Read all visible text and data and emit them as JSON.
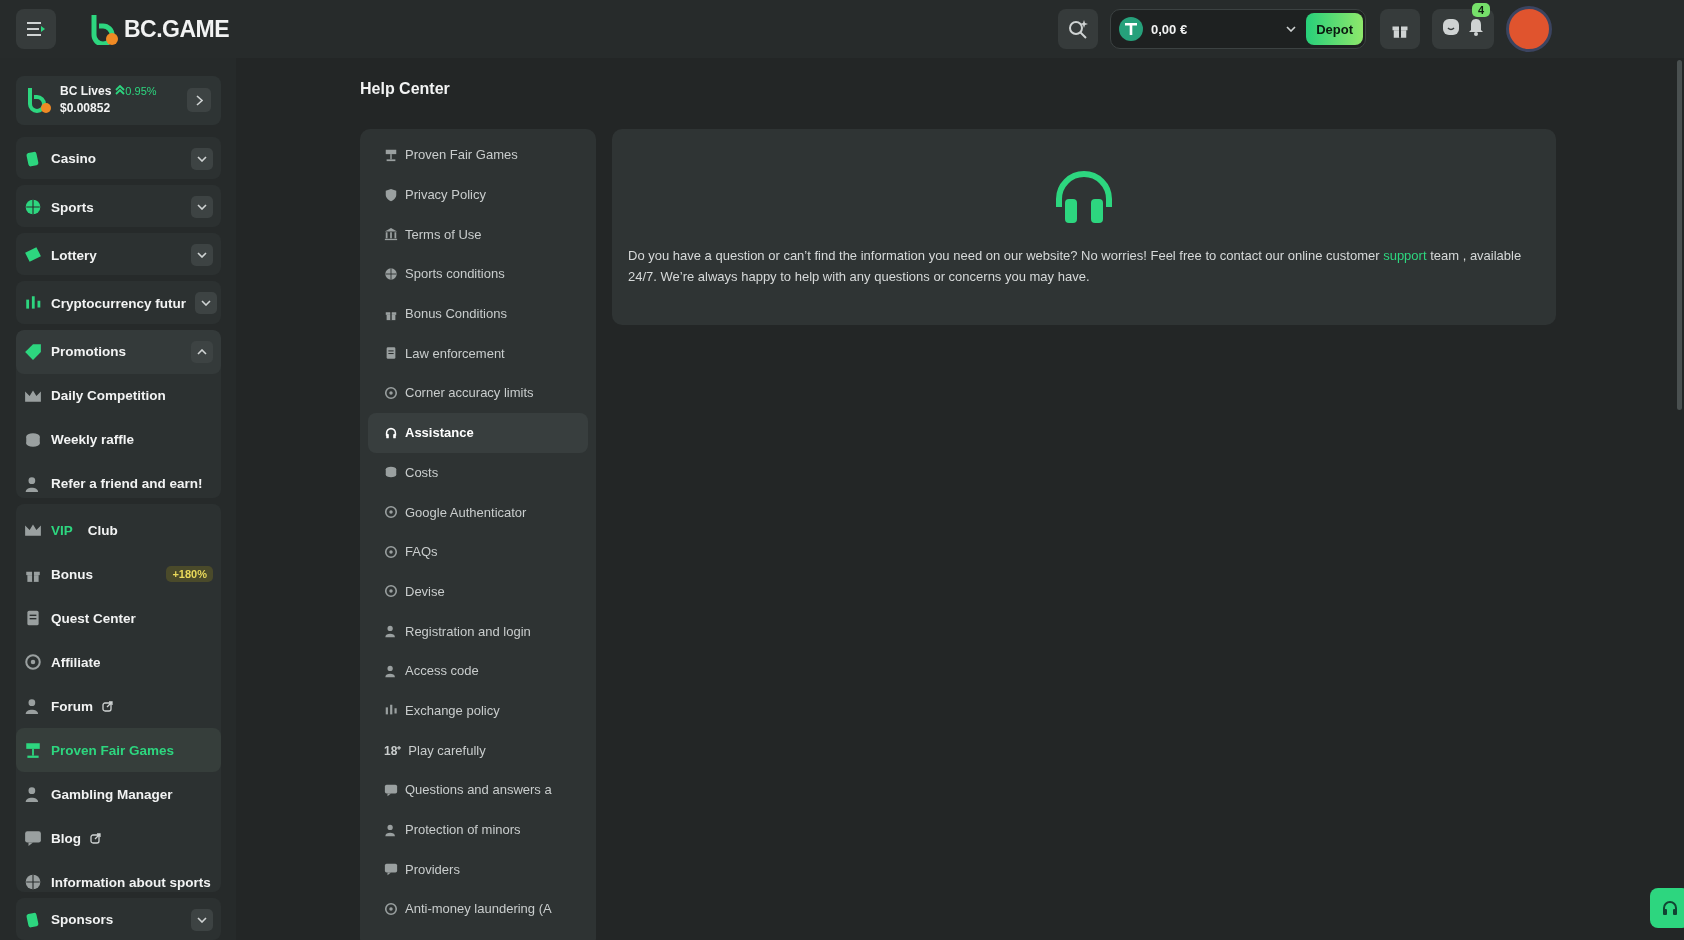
{
  "topbar": {
    "logo": "BC.GAME",
    "wallet": {
      "amount": "0,00 €",
      "deposit": "Depot"
    },
    "notifications": "4"
  },
  "sidebar": {
    "lives": {
      "name": "BC Lives",
      "change": "0.95%",
      "price": "$0.00852"
    },
    "sections": [
      {
        "kind": "group",
        "label": "Casino",
        "expanded": false
      },
      {
        "kind": "group",
        "label": "Sports",
        "expanded": false
      },
      {
        "kind": "group",
        "label": "Lottery",
        "expanded": false
      },
      {
        "kind": "group",
        "label": "Cryptocurrency futur",
        "expanded": false
      },
      {
        "kind": "group",
        "label": "Promotions",
        "expanded": true,
        "children": [
          {
            "label": "Daily Competition",
            "selected": false
          },
          {
            "label": "Weekly raffle",
            "selected": false
          },
          {
            "label": "Refer a friend and earn!",
            "selected": false
          }
        ]
      },
      {
        "kind": "list",
        "items": [
          {
            "prefix": "VIP",
            "label": "Club",
            "selected": false
          },
          {
            "label": "Bonus",
            "badge": "+180%",
            "selected": false
          },
          {
            "label": "Quest Center",
            "selected": false
          },
          {
            "label": "Affiliate",
            "selected": false
          },
          {
            "label": "Forum",
            "external": true,
            "selected": false
          },
          {
            "label": "Proven Fair Games",
            "selected": true
          },
          {
            "label": "Gambling Manager",
            "selected": false
          },
          {
            "label": "Blog",
            "external": true,
            "selected": false
          },
          {
            "label": "Information about sports",
            "selected": false
          }
        ]
      },
      {
        "kind": "group",
        "label": "Sponsors",
        "expanded": false
      }
    ]
  },
  "page": {
    "title": "Help Center"
  },
  "help_menu": [
    {
      "label": "Proven Fair Games",
      "selected": false
    },
    {
      "label": "Privacy Policy",
      "selected": false
    },
    {
      "label": "Terms of Use",
      "selected": false
    },
    {
      "label": "Sports conditions",
      "selected": false
    },
    {
      "label": "Bonus Conditions",
      "selected": false
    },
    {
      "label": "Law enforcement",
      "selected": false
    },
    {
      "label": "Corner accuracy limits",
      "selected": false
    },
    {
      "label": "Assistance",
      "selected": true
    },
    {
      "label": "Costs",
      "selected": false
    },
    {
      "label": "Google Authenticator",
      "selected": false
    },
    {
      "label": "FAQs",
      "selected": false
    },
    {
      "label": "Devise",
      "selected": false
    },
    {
      "label": "Registration and login",
      "selected": false
    },
    {
      "label": "Access code",
      "selected": false
    },
    {
      "label": "Exchange policy",
      "selected": false
    },
    {
      "label": "Play carefully",
      "prefix": "18⁺",
      "selected": false
    },
    {
      "label": "Questions and answers a",
      "selected": false
    },
    {
      "label": "Protection of minors",
      "selected": false
    },
    {
      "label": "Providers",
      "selected": false
    },
    {
      "label": "Anti-money laundering (A",
      "selected": false
    }
  ],
  "assistance": {
    "text_before": "Do you have a question or can’t find the information you need on our website? No worries! Feel free to contact our online customer ",
    "link": "support",
    "text_after": " team , available 24/7. We’re always happy to help with any questions or concerns you may have."
  }
}
